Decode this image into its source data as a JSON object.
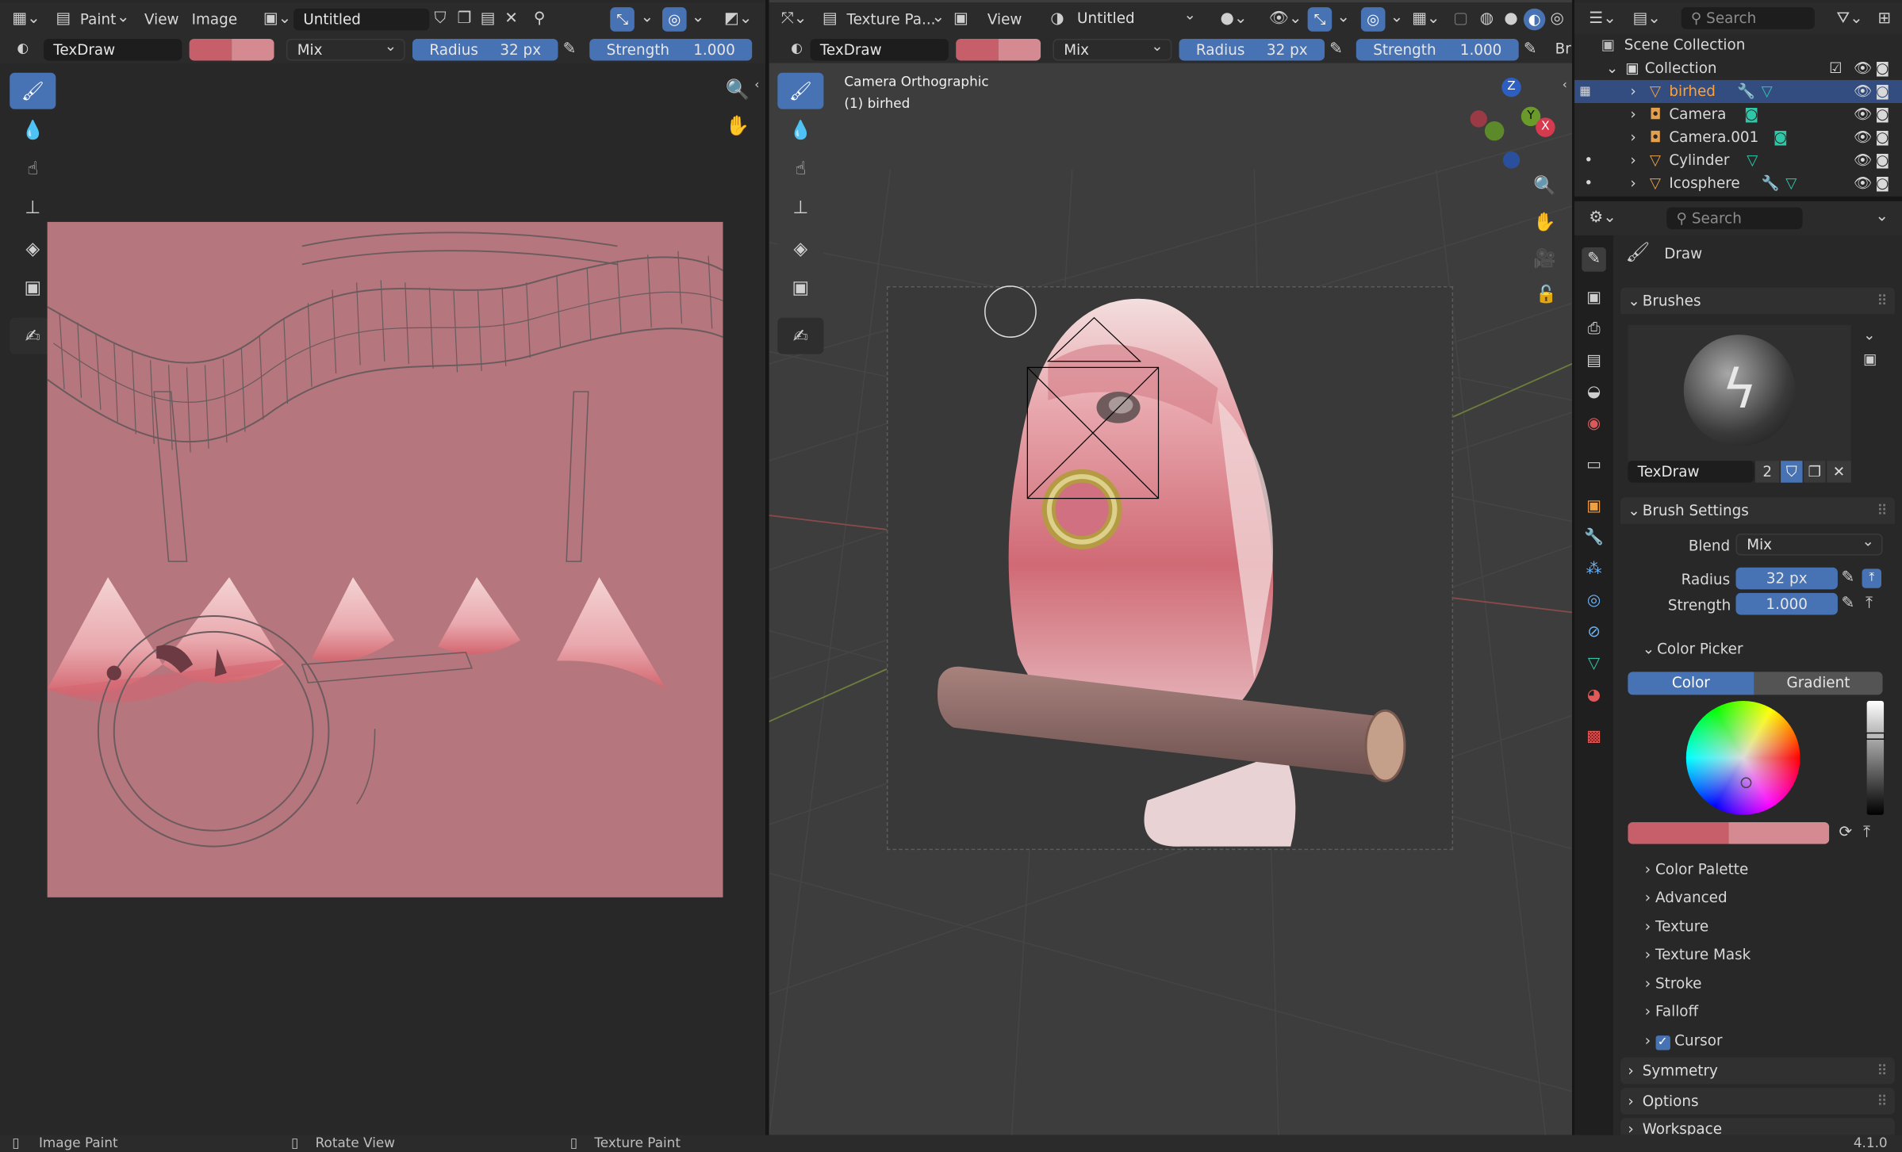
{
  "image_editor": {
    "header": {
      "mode": "Paint",
      "menu_view": "View",
      "menu_image": "Image",
      "image_name": "Untitled"
    },
    "tool_settings": {
      "brush": "TexDraw",
      "blend": "Mix",
      "radius_label": "Radius",
      "radius_value": "32 px",
      "strength_label": "Strength",
      "strength_value": "1.000"
    }
  },
  "viewport": {
    "header": {
      "mode": "Texture Pa...",
      "menu_view": "View",
      "image_name": "Untitled"
    },
    "tool_settings": {
      "brush": "TexDraw",
      "blend": "Mix",
      "radius_label": "Radius",
      "radius_value": "32 px",
      "strength_label": "Strength",
      "strength_value": "1.000",
      "overflow": "Br"
    },
    "overlay_camera": "Camera Orthographic",
    "overlay_object": "(1) birhed",
    "gizmo": {
      "z": "Z",
      "y": "Y",
      "x": "X"
    }
  },
  "outliner": {
    "search_placeholder": "Search",
    "root": "Scene Collection",
    "collection": "Collection",
    "items": [
      {
        "name": "birhed",
        "selected": true
      },
      {
        "name": "Camera",
        "selected": false
      },
      {
        "name": "Camera.001",
        "selected": false
      },
      {
        "name": "Cylinder",
        "selected": false
      },
      {
        "name": "Icosphere",
        "selected": false
      }
    ]
  },
  "properties": {
    "search_placeholder": "Search",
    "tool_name": "Draw",
    "brushes_panel": "Brushes",
    "brush_name": "TexDraw",
    "brush_users": "2",
    "brush_settings_panel": "Brush Settings",
    "blend_label": "Blend",
    "blend_value": "Mix",
    "radius_label": "Radius",
    "radius_value": "32 px",
    "strength_label": "Strength",
    "strength_value": "1.000",
    "color_picker_panel": "Color Picker",
    "tab_color": "Color",
    "tab_gradient": "Gradient",
    "subpanels": [
      "Color Palette",
      "Advanced",
      "Texture",
      "Texture Mask",
      "Stroke",
      "Falloff",
      "Cursor"
    ],
    "bottom_panels": [
      "Symmetry",
      "Options",
      "Workspace"
    ]
  },
  "statusbar": {
    "left": "Image Paint",
    "middle": "Rotate View",
    "right": "Texture Paint",
    "version": "4.1.0"
  },
  "colors": {
    "accent": "#4772b3",
    "brush_primary": "#c65f6a",
    "brush_secondary": "#d48a90",
    "texture_bg": "#b5767d",
    "selected_text": "#ffa033"
  }
}
